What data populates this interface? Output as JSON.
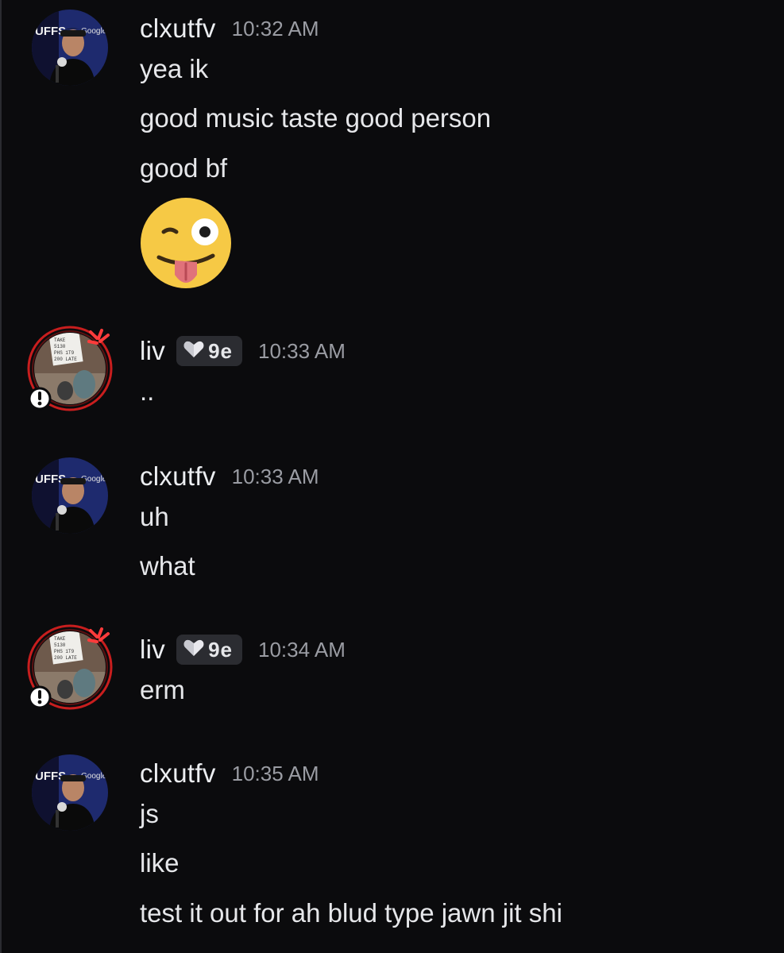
{
  "messages": [
    {
      "author": "clxutfv",
      "time": "10:32 AM",
      "lines": [
        "yea ik",
        "good music taste good person",
        "good bf"
      ],
      "emoji": "winking-face-with-tongue"
    },
    {
      "author": "liv",
      "tag": "9e",
      "time": "10:33 AM",
      "lines": [
        ".."
      ]
    },
    {
      "author": "clxutfv",
      "time": "10:33 AM",
      "lines": [
        "uh",
        "what"
      ]
    },
    {
      "author": "liv",
      "tag": "9e",
      "time": "10:34 AM",
      "lines": [
        "erm"
      ]
    },
    {
      "author": "clxutfv",
      "time": "10:35 AM",
      "lines": [
        "js",
        "like",
        "test it out for ah blud type jawn jit shi"
      ]
    }
  ],
  "avatar_text": {
    "clxutfv": [
      "UFFS",
      "Google"
    ],
    "liv": [
      "TAKE",
      "5130",
      "PHS 1T9",
      "200 LATE"
    ]
  },
  "colors": {
    "background": "#0b0b0d",
    "text": "#e6e7ea",
    "muted": "#9a9ca3",
    "tag_bg": "#2b2c31",
    "ring": "#c81e1e"
  }
}
